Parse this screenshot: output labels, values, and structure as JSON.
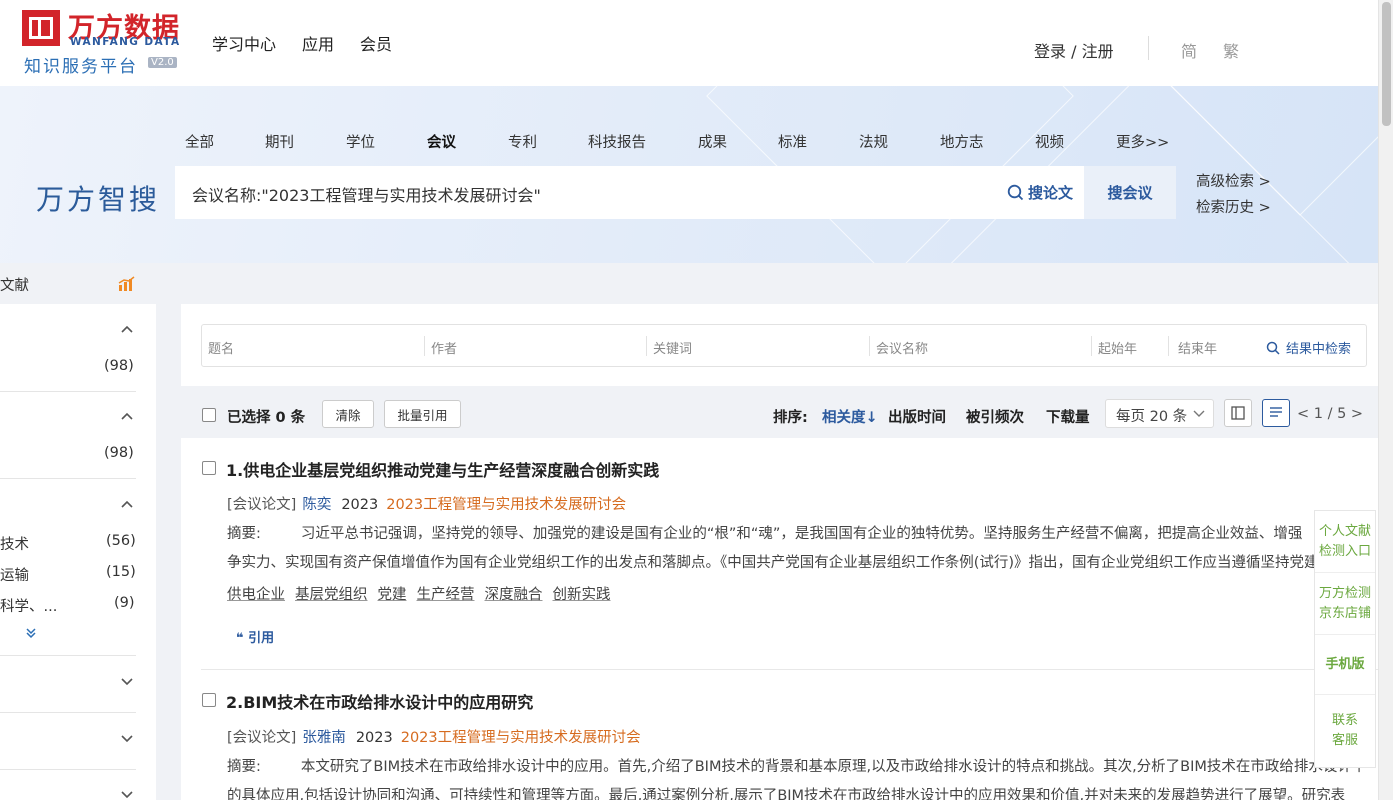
{
  "header": {
    "logo_cn": "万方数据",
    "logo_en": "WANFANG DATA",
    "logo_sub": "知识服务平台",
    "logo_version": "V2.0",
    "nav": [
      "学习中心",
      "应用",
      "会员"
    ],
    "login": "登录 / 注册",
    "lang_simplified": "简",
    "lang_traditional": "繁"
  },
  "search": {
    "brand": "万方智搜",
    "categories": [
      "全部",
      "期刊",
      "学位",
      "会议",
      "专利",
      "科技报告",
      "成果",
      "标准",
      "法规",
      "地方志",
      "视频",
      "更多>>"
    ],
    "active_category": "会议",
    "query": "会议名称:\"2023工程管理与实用技术发展研讨会\"",
    "search_paper_label": "搜论文",
    "search_conf_label": "搜会议",
    "advanced": "高级检索 >",
    "history": "检索历史 >"
  },
  "sidebar": {
    "title": "文献",
    "group1_count": "(98)",
    "group2_count": "(98)",
    "items": [
      {
        "label": "技术",
        "count": "(56)"
      },
      {
        "label": "运输",
        "count": "(15)"
      },
      {
        "label": "科学、...",
        "count": "(9)"
      }
    ]
  },
  "filter": {
    "fields": [
      "题名",
      "作者",
      "关键词",
      "会议名称",
      "起始年",
      "结束年"
    ],
    "search_label": "结果中检索"
  },
  "toolbar": {
    "selected": "已选择 0 条",
    "clear": "清除",
    "batch_cite": "批量引用",
    "sort_label": "排序:",
    "sort_relevance": "相关度",
    "sort_date": "出版时间",
    "sort_cited": "被引频次",
    "sort_downloads": "下载量",
    "per_page": "每页 20 条",
    "pager": "< 1 / 5 >"
  },
  "results": [
    {
      "title": "1.供电企业基层党组织推动党建与生产经营深度融合创新实践",
      "type": "[会议论文]",
      "author": "陈奕",
      "year": "2023",
      "conference": "2023工程管理与实用技术发展研讨会",
      "abstract_label": "摘要:",
      "abstract_line1": "习近平总书记强调，坚持党的领导、加强党的建设是国有企业的“根”和“魂”，是我国国有企业的独特优势。坚持服务生产经营不偏离，把提高企业效益、增强",
      "abstract_line2": "争实力、实现国有资产保值增值作为国有企业党组织工作的出发点和落脚点。《中国共产党国有企业基层组织工作条例(试行)》指出，国有企业党组织工作应当遵循坚持党建",
      "keywords": [
        "供电企业",
        "基层党组织",
        "党建",
        "生产经营",
        "深度融合",
        "创新实践"
      ],
      "cite": "引用"
    },
    {
      "title": "2.BIM技术在市政给排水设计中的应用研究",
      "type": "[会议论文]",
      "author": "张雅南",
      "year": "2023",
      "conference": "2023工程管理与实用技术发展研讨会",
      "abstract_label": "摘要:",
      "abstract_line1": "本文研究了BIM技术在市政给排水设计中的应用。首先,介绍了BIM技术的背景和基本原理,以及市政给排水设计的特点和挑战。其次,分析了BIM技术在市政给排水设计中",
      "abstract_line2": "的具体应用,包括设计协同和沟通、可持续性和管理等方面。最后,通过案例分析,展示了BIM技术在市政给排水设计中的应用效果和价值,并对未来的发展趋势进行了展望。研究表"
    }
  ],
  "float_panel": [
    "个人文献检测入口",
    "万方检测京东店铺",
    "手机版",
    "联系客服"
  ]
}
